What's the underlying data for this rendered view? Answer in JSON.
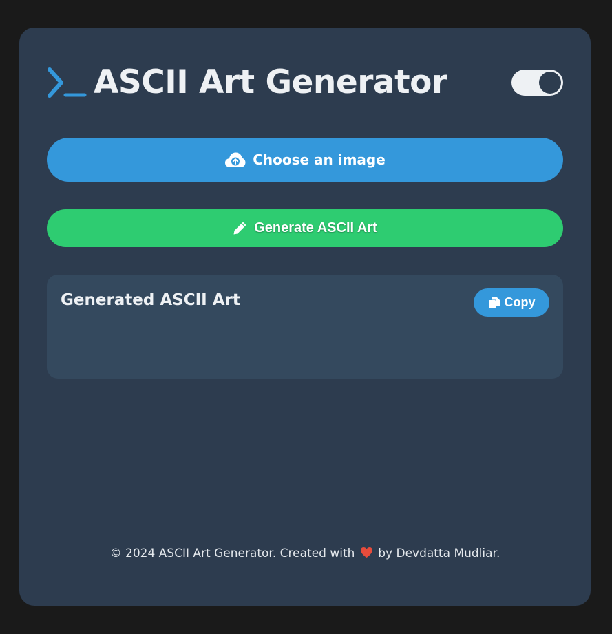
{
  "app": {
    "title": "ASCII Art Generator",
    "logo_icon": "terminal-prompt-icon",
    "theme_toggle": {
      "state": "on"
    }
  },
  "actions": {
    "upload_label": "Choose an image",
    "upload_icon": "cloud-upload-icon",
    "generate_label": "Generate ASCII Art",
    "generate_icon": "pencil-icon"
  },
  "output": {
    "title": "Generated ASCII Art",
    "copy_label": "Copy",
    "copy_icon": "copy-icon",
    "content": ""
  },
  "footer": {
    "text_before": "© 2024 ASCII Art Generator. Created with",
    "heart_icon": "heart-icon",
    "text_after": "by Devdatta Mudliar."
  },
  "colors": {
    "page_bg": "#1a1a1a",
    "card_bg": "#2d3c4f",
    "panel_bg": "#34495e",
    "accent_blue": "#3498db",
    "accent_green": "#2ecc71",
    "heart_red": "#e74c3c",
    "text": "#eef1f4"
  }
}
